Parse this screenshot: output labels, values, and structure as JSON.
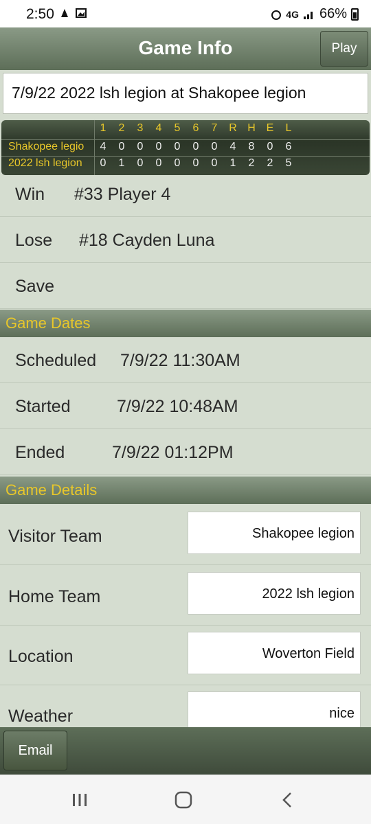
{
  "status_bar": {
    "time": "2:50",
    "battery": "66%",
    "signal_text": "4G"
  },
  "header": {
    "title": "Game Info",
    "play_label": "Play"
  },
  "game_title": "7/9/22 2022 lsh legion at Shakopee legion",
  "scoreboard": {
    "headers": [
      "1",
      "2",
      "3",
      "4",
      "5",
      "6",
      "7",
      "R",
      "H",
      "E",
      "L"
    ],
    "teams": [
      {
        "name": "Shakopee legio",
        "values": [
          "4",
          "0",
          "0",
          "0",
          "0",
          "0",
          "0",
          "4",
          "8",
          "0",
          "6"
        ]
      },
      {
        "name": "2022 lsh legion",
        "values": [
          "0",
          "1",
          "0",
          "0",
          "0",
          "0",
          "0",
          "1",
          "2",
          "2",
          "5"
        ]
      }
    ]
  },
  "decisions": {
    "win_label": "Win",
    "win_value": "#33 Player 4",
    "lose_label": "Lose",
    "lose_value": "#18 Cayden Luna",
    "save_label": "Save"
  },
  "game_dates": {
    "section_title": "Game Dates",
    "scheduled_label": "Scheduled",
    "scheduled_value": "7/9/22 11:30AM",
    "started_label": "Started",
    "started_value": "7/9/22 10:48AM",
    "ended_label": "Ended",
    "ended_value": "7/9/22 01:12PM"
  },
  "game_details": {
    "section_title": "Game Details",
    "visitor_label": "Visitor Team",
    "visitor_value": "Shakopee legion",
    "home_label": "Home Team",
    "home_value": "2022 lsh legion",
    "location_label": "Location",
    "location_value": "Woverton Field",
    "weather_label": "Weather",
    "weather_value": "nice"
  },
  "footer": {
    "email_label": "Email"
  },
  "colors": {
    "accent_yellow": "#e8c72a",
    "header_green": "#5d6e58",
    "background": "#d5ddd0"
  }
}
